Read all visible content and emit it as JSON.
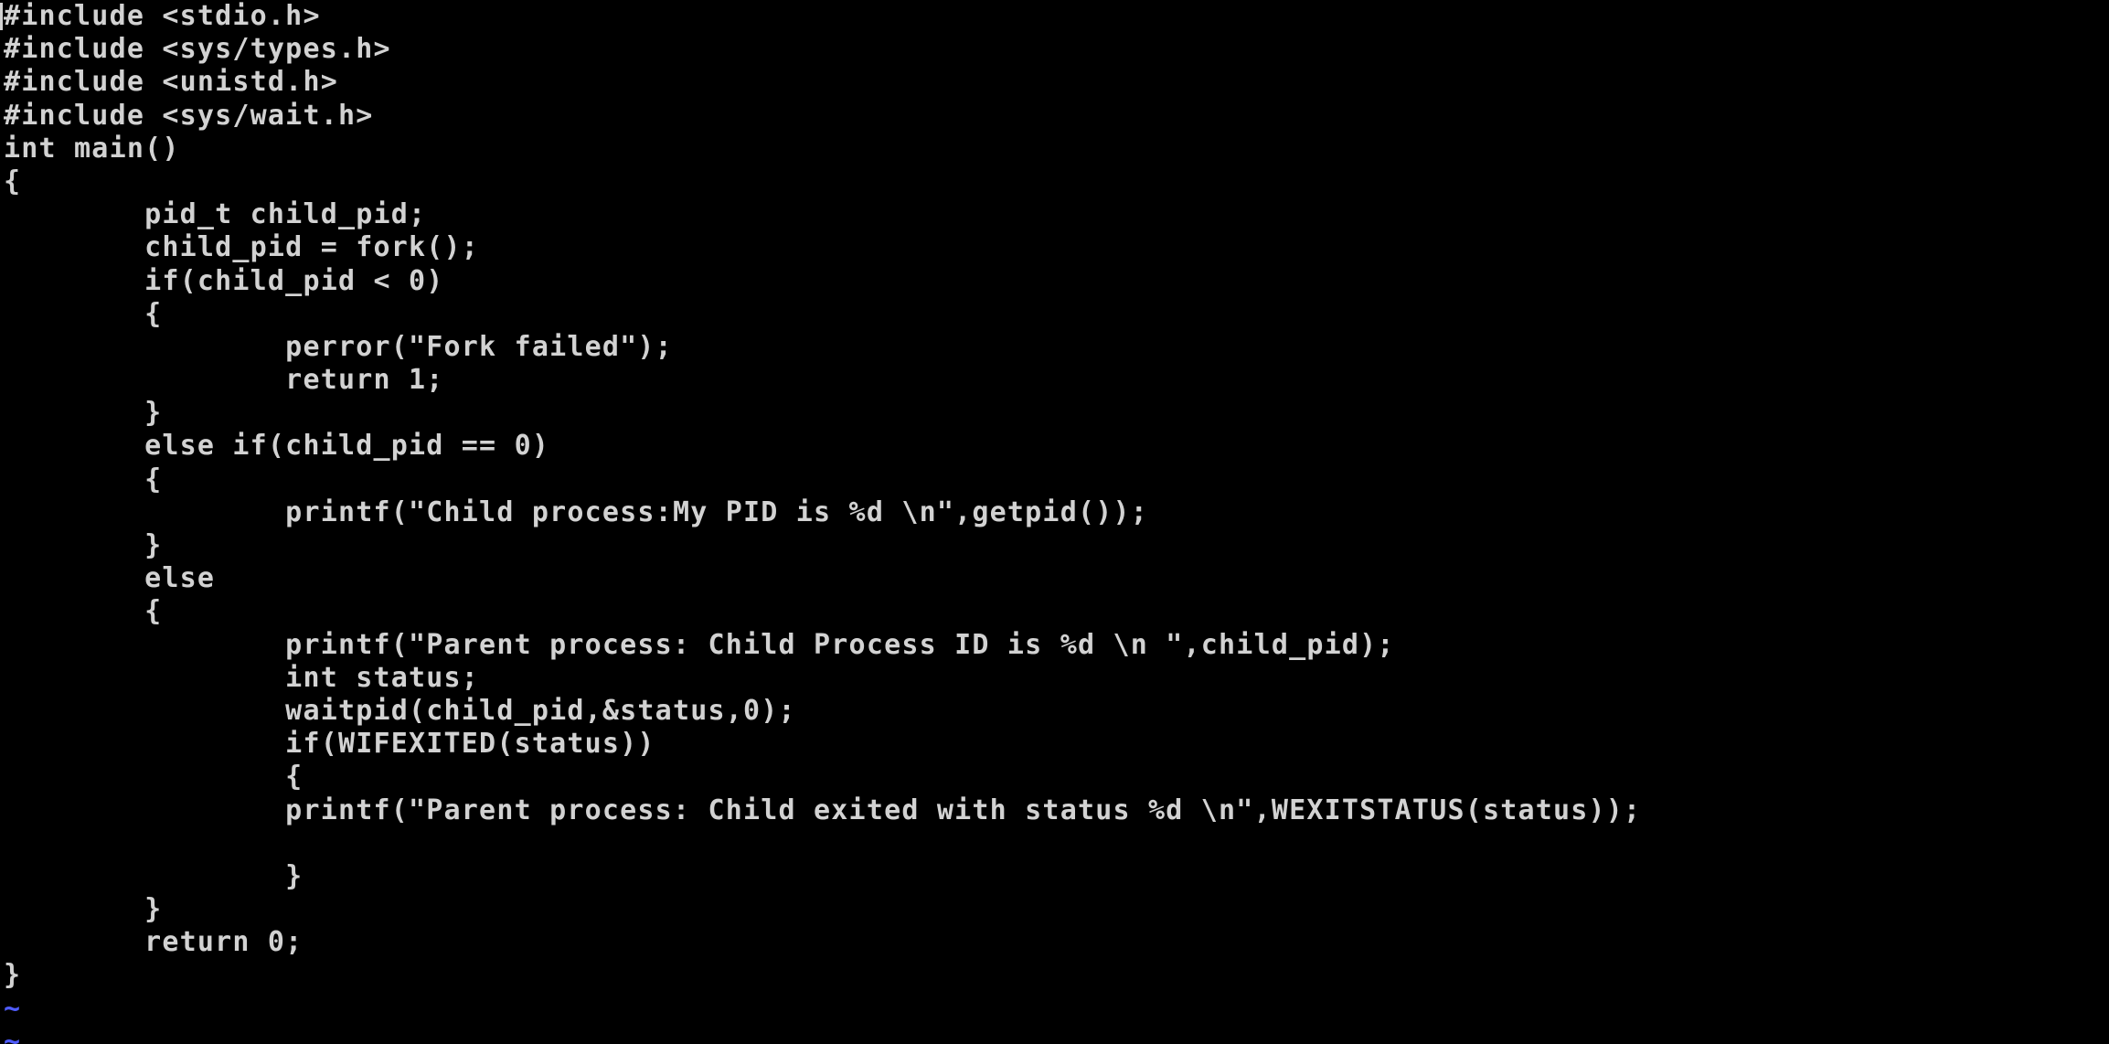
{
  "editor": {
    "lines": [
      "#include <stdio.h>",
      "#include <sys/types.h>",
      "#include <unistd.h>",
      "#include <sys/wait.h>",
      "int main()",
      "{",
      "        pid_t child_pid;",
      "        child_pid = fork();",
      "        if(child_pid < 0)",
      "        {",
      "                perror(\"Fork failed\");",
      "                return 1;",
      "        }",
      "        else if(child_pid == 0)",
      "        {",
      "                printf(\"Child process:My PID is %d \\n\",getpid());",
      "        }",
      "        else",
      "        {",
      "                printf(\"Parent process: Child Process ID is %d \\n \",child_pid);",
      "                int status;",
      "                waitpid(child_pid,&status,0);",
      "                if(WIFEXITED(status))",
      "                {",
      "                printf(\"Parent process: Child exited with status %d \\n\",WEXITSTATUS(status));",
      "",
      "                }",
      "        }",
      "        return 0;",
      "}"
    ],
    "tildes": [
      "~",
      "~"
    ]
  },
  "colors": {
    "background": "#000000",
    "text": "#d2d2d2",
    "tilde": "#4f5cff"
  }
}
